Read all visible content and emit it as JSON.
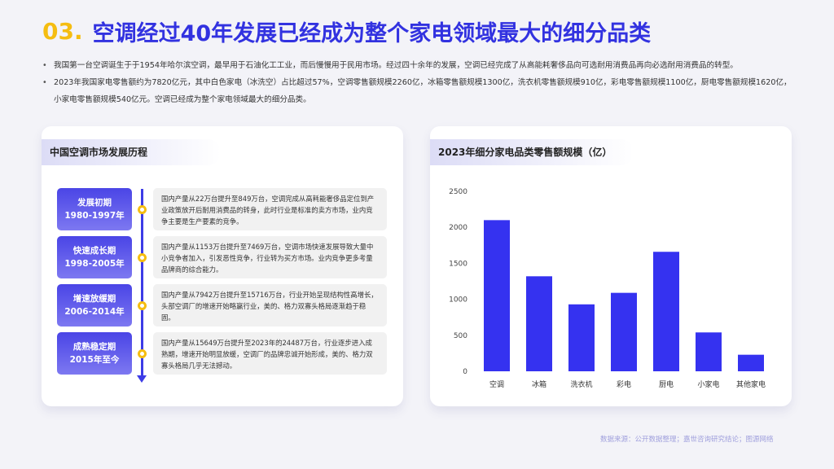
{
  "header": {
    "number": "03.",
    "title": "空调经过40年发展已经成为整个家电领域最大的细分品类"
  },
  "bullets": [
    "我国第一台空调诞生于于1954年哈尔滨空调，最早用于石油化工工业，而后慢慢用于民用市场。经过四十余年的发展，空调已经完成了从高能耗奢侈品向可选耐用消费品再向必选耐用消费品的转型。",
    "2023年我国家电零售额约为7820亿元，其中白色家电（冰洗空）占比超过57%，空调零售额规模2260亿，冰箱零售额规模1300亿，洗衣机零售额规模910亿，彩电零售额规模1100亿，厨电零售额规模1620亿，小家电零售额规模540亿元。空调已经成为整个家电领域最大的细分品类。"
  ],
  "timeline": {
    "title": "中国空调市场发展历程",
    "phases": [
      {
        "name": "发展初期",
        "years": "1980-1997年",
        "desc": "国内产量从22万台提升至849万台，空调完成从高耗能奢侈品定位到产业政策放开后耐用消费品的转身，此时行业是标准的卖方市场，业内竞争主要是生产要素的竞争。"
      },
      {
        "name": "快速成长期",
        "years": "1998-2005年",
        "desc": "国内产量从1153万台提升至7469万台，空调市场快速发展导致大量中小竞争者加入，引发恶性竞争，行业转为买方市场。业内竞争更多考量品牌商的综合能力。"
      },
      {
        "name": "增速放缓期",
        "years": "2006-2014年",
        "desc": "国内产量从7942万台提升至15716万台，行业开始呈现结构性高增长，头部空调厂的增速开始略赢行业，美的、格力双寡头格局逐渐趋于稳固。"
      },
      {
        "name": "成熟稳定期",
        "years": "2015年至今",
        "desc": "国内产量从15649万台提升至2023年的24487万台，行业逐步进入成熟期，增速开始明显放缓，空调厂的品牌忠诚开始形成，美的、格力双寡头格局几乎无法撼动。"
      }
    ]
  },
  "chart_card": {
    "title": "2023年细分家电品类零售额规模（亿）"
  },
  "chart_data": {
    "type": "bar",
    "title": "2023年细分家电品类零售额规模（亿）",
    "categories": [
      "空调",
      "冰箱",
      "洗衣机",
      "彩电",
      "厨电",
      "小家电",
      "其他家电"
    ],
    "values": [
      2100,
      1320,
      930,
      1090,
      1660,
      540,
      230
    ],
    "ylim": [
      0,
      2500
    ],
    "yticks": [
      0,
      500,
      1000,
      1500,
      2000,
      2500
    ],
    "grid": false,
    "bar_color": "#3532f0"
  },
  "source": "数据来源：公开数据整理；嘉世咨询研究结论；图源网络",
  "colors": {
    "accent_blue": "#3232e0",
    "accent_yellow": "#f5bd11"
  }
}
